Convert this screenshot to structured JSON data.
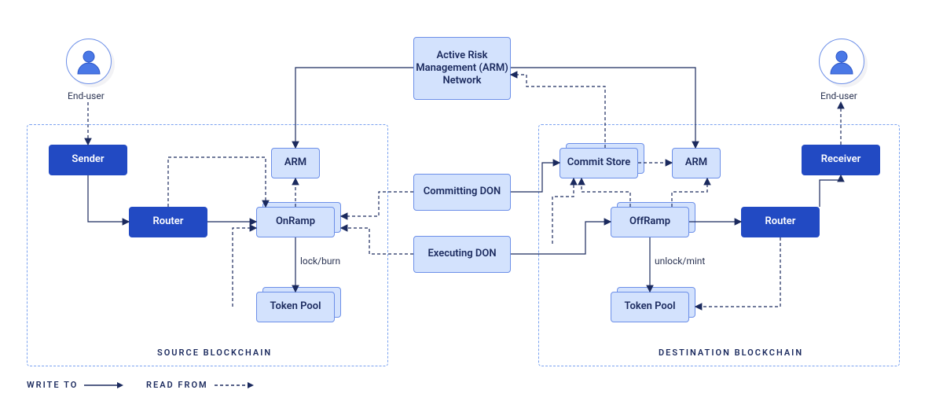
{
  "users": {
    "left_label": "End-user",
    "right_label": "End-user"
  },
  "source": {
    "title": "SOURCE BLOCKCHAIN",
    "sender": "Sender",
    "router": "Router",
    "arm": "ARM",
    "onramp": "OnRamp",
    "tokenpool": "Token Pool",
    "lockburn": "lock/burn"
  },
  "middle": {
    "armnet": "Active Risk Management (ARM) Network",
    "committing": "Committing DON",
    "executing": "Executing DON"
  },
  "dest": {
    "title": "DESTINATION BLOCKCHAIN",
    "commit": "Commit Store",
    "arm": "ARM",
    "offramp": "OffRamp",
    "tokenpool": "Token Pool",
    "router": "Router",
    "receiver": "Receiver",
    "unlockmint": "unlock/mint"
  },
  "legend": {
    "write": "WRITE TO",
    "read": "READ FROM"
  }
}
